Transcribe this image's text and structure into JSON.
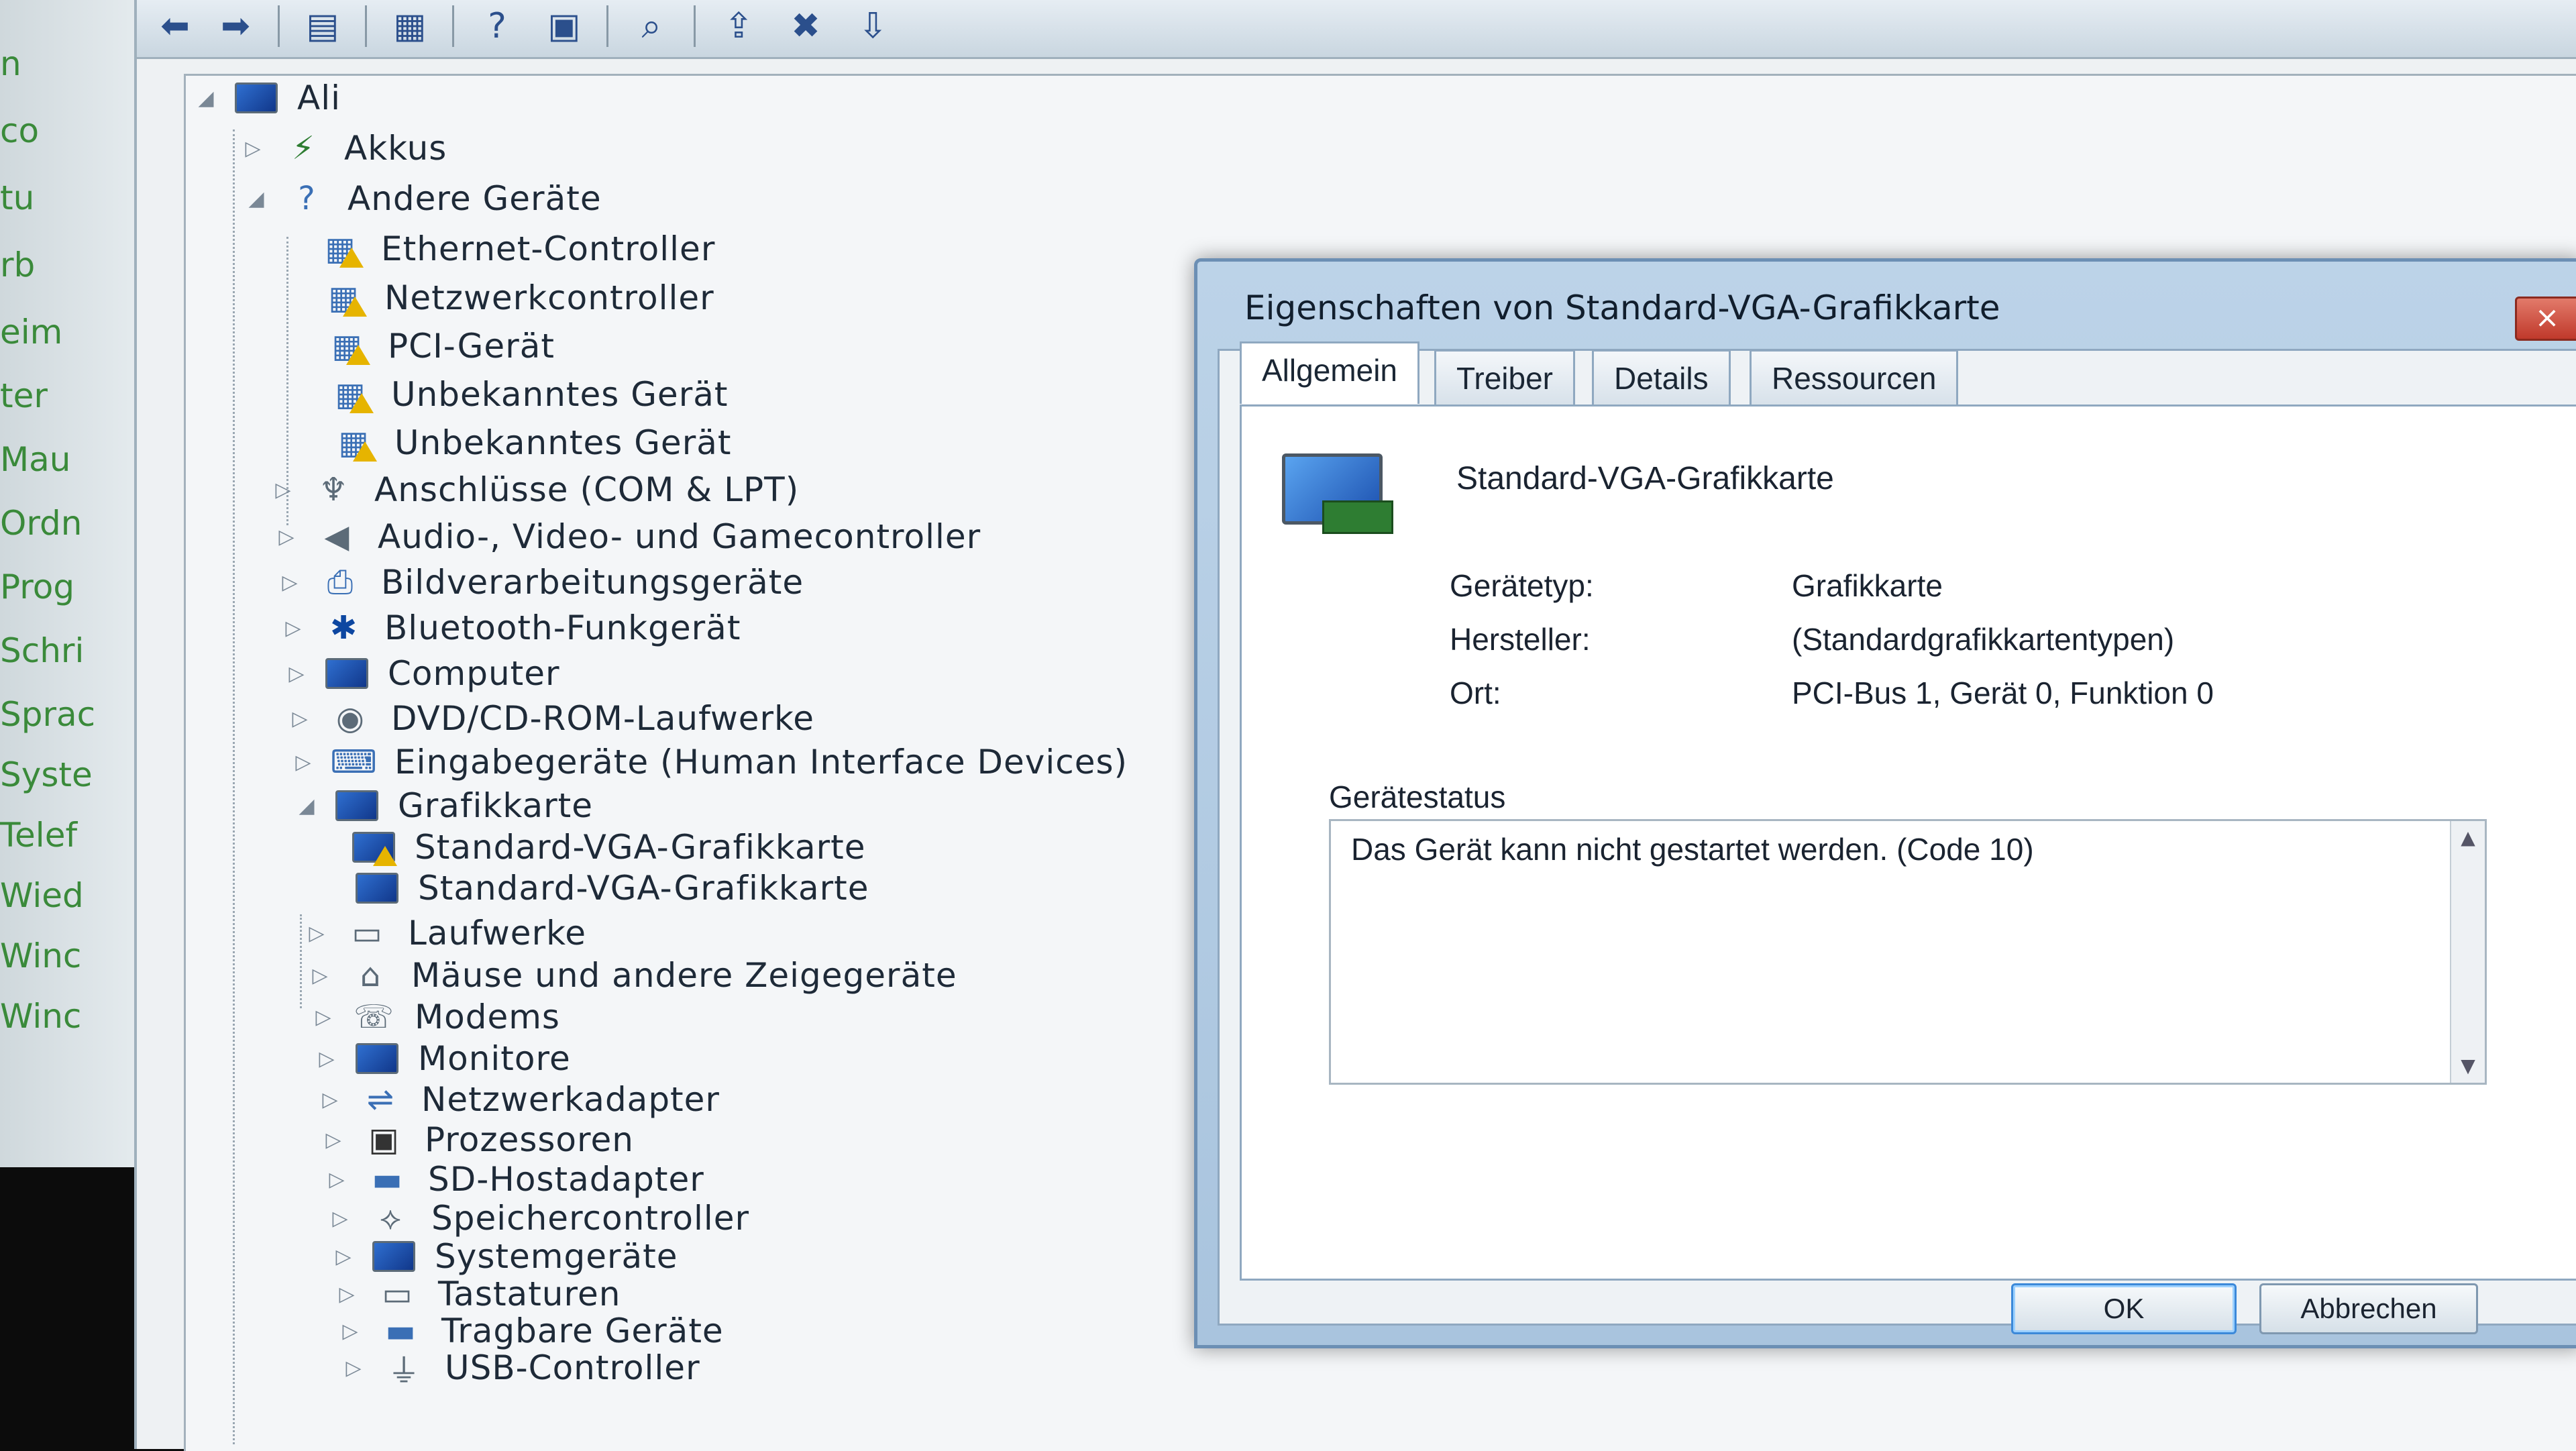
{
  "background": {
    "items": [
      "n",
      "co",
      "tu",
      "rb",
      "eim",
      "ter",
      "Mau",
      "Ordn",
      "Prog",
      "Schri",
      "Sprac",
      "Syste",
      "Telef",
      "Wied",
      "Winc",
      "Winc"
    ]
  },
  "tree": {
    "root": "Ali",
    "nodes": [
      {
        "label": "Akkus",
        "icon": "battery-icon",
        "expander": "▷"
      },
      {
        "label": "Andere Geräte",
        "icon": "unknown-device-icon",
        "expander": "◢"
      },
      {
        "label": "Ethernet-Controller",
        "icon": "warning-device-icon",
        "expander": ""
      },
      {
        "label": "Netzwerkcontroller",
        "icon": "warning-device-icon",
        "expander": ""
      },
      {
        "label": "PCI-Gerät",
        "icon": "warning-device-icon",
        "expander": ""
      },
      {
        "label": "Unbekanntes Gerät",
        "icon": "warning-device-icon",
        "expander": ""
      },
      {
        "label": "Unbekanntes Gerät",
        "icon": "warning-device-icon",
        "expander": ""
      },
      {
        "label": "Anschlüsse (COM & LPT)",
        "icon": "port-icon",
        "expander": "▷"
      },
      {
        "label": "Audio-, Video- und Gamecontroller",
        "icon": "speaker-icon",
        "expander": "▷"
      },
      {
        "label": "Bildverarbeitungsgeräte",
        "icon": "scanner-icon",
        "expander": "▷"
      },
      {
        "label": "Bluetooth-Funkgerät",
        "icon": "bluetooth-icon",
        "expander": "▷"
      },
      {
        "label": "Computer",
        "icon": "computer-icon",
        "expander": "▷"
      },
      {
        "label": "DVD/CD-ROM-Laufwerke",
        "icon": "dvd-drive-icon",
        "expander": "▷"
      },
      {
        "label": "Eingabegeräte (Human Interface Devices)",
        "icon": "hid-icon",
        "expander": "▷"
      },
      {
        "label": "Grafikkarte",
        "icon": "display-adapter-icon",
        "expander": "◢"
      },
      {
        "label": "Standard-VGA-Grafikkarte",
        "icon": "warning-display-icon",
        "expander": ""
      },
      {
        "label": "Standard-VGA-Grafikkarte",
        "icon": "display-adapter-icon",
        "expander": ""
      },
      {
        "label": "Laufwerke",
        "icon": "disk-drive-icon",
        "expander": "▷"
      },
      {
        "label": "Mäuse und andere Zeigegeräte",
        "icon": "mouse-icon",
        "expander": "▷"
      },
      {
        "label": "Modems",
        "icon": "modem-icon",
        "expander": "▷"
      },
      {
        "label": "Monitore",
        "icon": "monitor-icon",
        "expander": "▷"
      },
      {
        "label": "Netzwerkadapter",
        "icon": "network-adapter-icon",
        "expander": "▷"
      },
      {
        "label": "Prozessoren",
        "icon": "processor-icon",
        "expander": "▷"
      },
      {
        "label": "SD-Hostadapter",
        "icon": "sd-card-icon",
        "expander": "▷"
      },
      {
        "label": "Speichercontroller",
        "icon": "storage-controller-icon",
        "expander": "▷"
      },
      {
        "label": "Systemgeräte",
        "icon": "system-device-icon",
        "expander": "▷"
      },
      {
        "label": "Tastaturen",
        "icon": "keyboard-icon",
        "expander": "▷"
      },
      {
        "label": "Tragbare Geräte",
        "icon": "portable-device-icon",
        "expander": "▷"
      },
      {
        "label": "USB-Controller",
        "icon": "usb-icon",
        "expander": "▷"
      }
    ]
  },
  "toolbar": {
    "buttons": [
      "back-arrow-icon",
      "forward-arrow-icon",
      "console-tree-icon",
      "properties-icon",
      "help-icon",
      "action-pane-icon",
      "scan-hardware-icon",
      "update-driver-icon",
      "uninstall-icon",
      "disable-icon"
    ]
  },
  "dialog": {
    "title": "Eigenschaften von Standard-VGA-Grafikkarte",
    "close": "×",
    "tabs": [
      "Allgemein",
      "Treiber",
      "Details",
      "Ressourcen"
    ],
    "device_name": "Standard-VGA-Grafikkarte",
    "properties": [
      {
        "label": "Gerätetyp:",
        "value": "Grafikkarte"
      },
      {
        "label": "Hersteller:",
        "value": "(Standardgrafikkartentypen)"
      },
      {
        "label": "Ort:",
        "value": "PCI-Bus 1, Gerät 0, Funktion 0"
      }
    ],
    "status_label": "Gerätestatus",
    "status_text": "Das Gerät kann nicht gestartet werden. (Code 10)",
    "ok": "OK",
    "cancel": "Abbrechen"
  }
}
